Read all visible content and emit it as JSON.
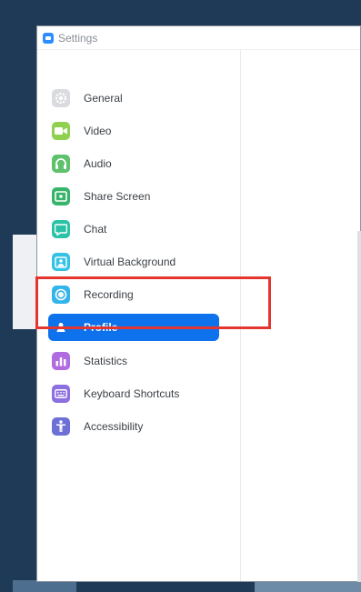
{
  "window": {
    "title": "Settings"
  },
  "sidebar": {
    "items": [
      {
        "id": "general",
        "label": "General",
        "icon": "gear-icon",
        "color": "#d9dbde",
        "active": false
      },
      {
        "id": "video",
        "label": "Video",
        "icon": "video-camera-icon",
        "color": "#8fd14f",
        "active": false
      },
      {
        "id": "audio",
        "label": "Audio",
        "icon": "headphones-icon",
        "color": "#5ec16b",
        "active": false
      },
      {
        "id": "share-screen",
        "label": "Share Screen",
        "icon": "share-screen-icon",
        "color": "#37b46a",
        "active": false
      },
      {
        "id": "chat",
        "label": "Chat",
        "icon": "chat-bubble-icon",
        "color": "#2cc2a6",
        "active": false
      },
      {
        "id": "virtual-background",
        "label": "Virtual Background",
        "icon": "virtual-background-icon",
        "color": "#33c1e8",
        "active": false
      },
      {
        "id": "recording",
        "label": "Recording",
        "icon": "record-icon",
        "color": "#33b5ea",
        "active": false
      },
      {
        "id": "profile",
        "label": "Profile",
        "icon": "person-icon",
        "color": "#0e72ed",
        "active": true
      },
      {
        "id": "statistics",
        "label": "Statistics",
        "icon": "bar-chart-icon",
        "color": "#b16be0",
        "active": false
      },
      {
        "id": "keyboard-shortcuts",
        "label": "Keyboard Shortcuts",
        "icon": "keyboard-icon",
        "color": "#8c6fe0",
        "active": false
      },
      {
        "id": "accessibility",
        "label": "Accessibility",
        "icon": "accessibility-icon",
        "color": "#6b6fd6",
        "active": false
      }
    ]
  },
  "colors": {
    "accent": "#0e72ed",
    "highlight": "#e5352f"
  }
}
